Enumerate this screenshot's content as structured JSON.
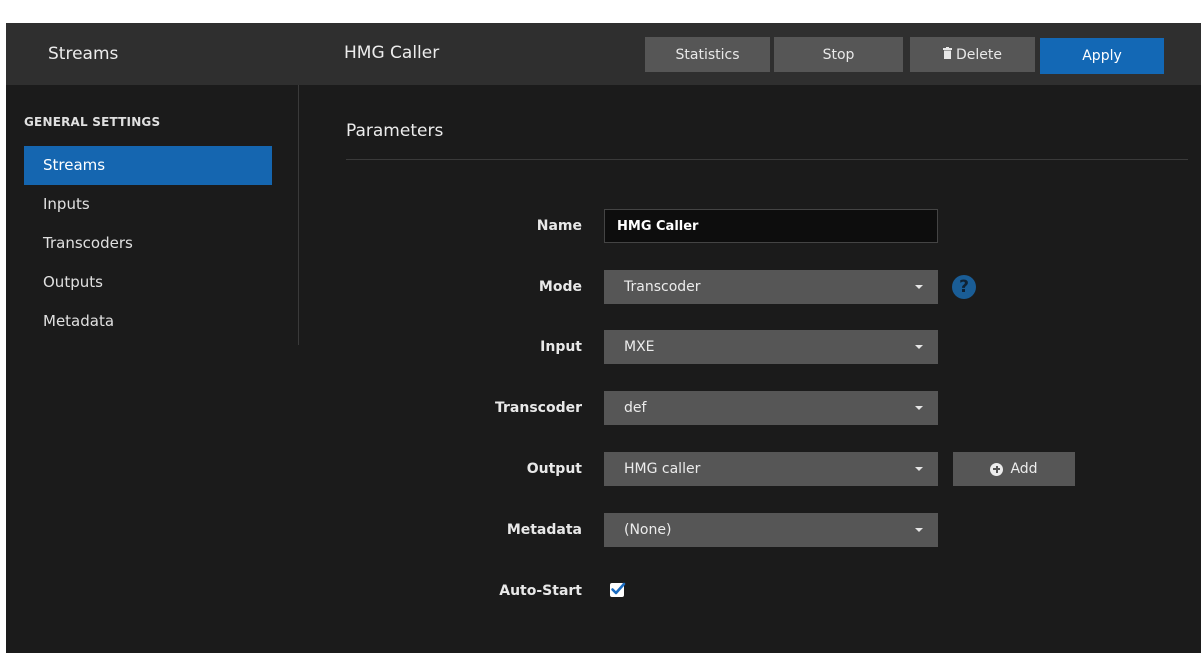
{
  "header": {
    "section": "Streams",
    "title": "HMG Caller",
    "buttons": {
      "statistics": "Statistics",
      "stop": "Stop",
      "delete": "Delete",
      "apply": "Apply"
    }
  },
  "sidebar": {
    "heading": "GENERAL SETTINGS",
    "items": [
      {
        "label": "Streams",
        "active": true
      },
      {
        "label": "Inputs"
      },
      {
        "label": "Transcoders"
      },
      {
        "label": "Outputs"
      },
      {
        "label": "Metadata"
      }
    ]
  },
  "main": {
    "section_title": "Parameters",
    "fields": {
      "name": {
        "label": "Name",
        "value": "HMG Caller"
      },
      "mode": {
        "label": "Mode",
        "value": "Transcoder",
        "help_icon": "?"
      },
      "input": {
        "label": "Input",
        "value": "MXE"
      },
      "transcoder": {
        "label": "Transcoder",
        "value": "def"
      },
      "output": {
        "label": "Output",
        "value": "HMG caller",
        "add_label": "Add"
      },
      "metadata": {
        "label": "Metadata",
        "value": "(None)"
      },
      "auto_start": {
        "label": "Auto-Start",
        "checked": true
      }
    }
  },
  "colors": {
    "accent": "#1566b0",
    "header_bg": "#2f2f2f",
    "page_bg": "#1b1b1b",
    "control_bg": "#565656"
  }
}
